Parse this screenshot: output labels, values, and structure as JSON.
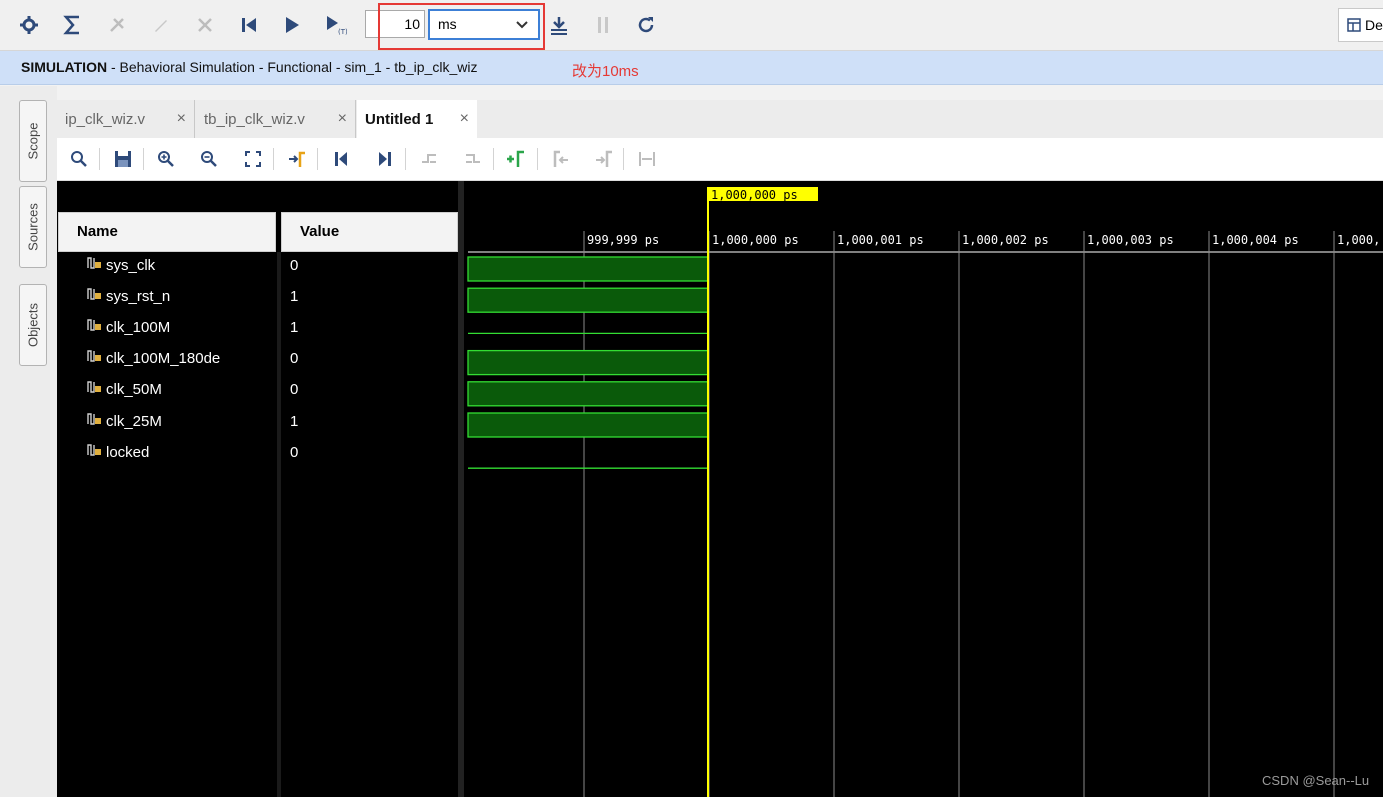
{
  "toolbar": {
    "run_time_value": "10",
    "run_time_unit": "ms",
    "layout_button_label": "De"
  },
  "banner": {
    "mode": "SIMULATION",
    "details": " - Behavioral Simulation - Functional - sim_1 - tb_ip_clk_wiz"
  },
  "annotation_text": "改为10ms",
  "side_tabs": [
    "Scope",
    "Sources",
    "Objects"
  ],
  "doc_tabs": [
    {
      "label": "ip_clk_wiz.v",
      "active": false
    },
    {
      "label": "tb_ip_clk_wiz.v",
      "active": false
    },
    {
      "label": "Untitled 1",
      "active": true
    }
  ],
  "columns": {
    "name": "Name",
    "value": "Value"
  },
  "signals": [
    {
      "name": "sys_clk",
      "value": "0"
    },
    {
      "name": "sys_rst_n",
      "value": "1"
    },
    {
      "name": "clk_100M",
      "value": "1"
    },
    {
      "name": "clk_100M_180de",
      "value": "0"
    },
    {
      "name": "clk_50M",
      "value": "0"
    },
    {
      "name": "clk_25M",
      "value": "1"
    },
    {
      "name": "locked",
      "value": "0"
    }
  ],
  "timeline": {
    "cursor_label": "1,000,000 ps",
    "ticks": [
      "999,999 ps",
      "1,000,000 ps",
      "1,000,001 ps",
      "1,000,002 ps",
      "1,000,003 ps",
      "1,000,004 ps",
      "1,000,"
    ]
  },
  "watermark": "CSDN @Sean--Lu",
  "colors": {
    "wave_green": "#33dd33",
    "wave_fill": "#0a5a0a",
    "cursor": "#ffff00",
    "highlight_red": "#e53935",
    "banner_bg": "#cfe0f8"
  }
}
